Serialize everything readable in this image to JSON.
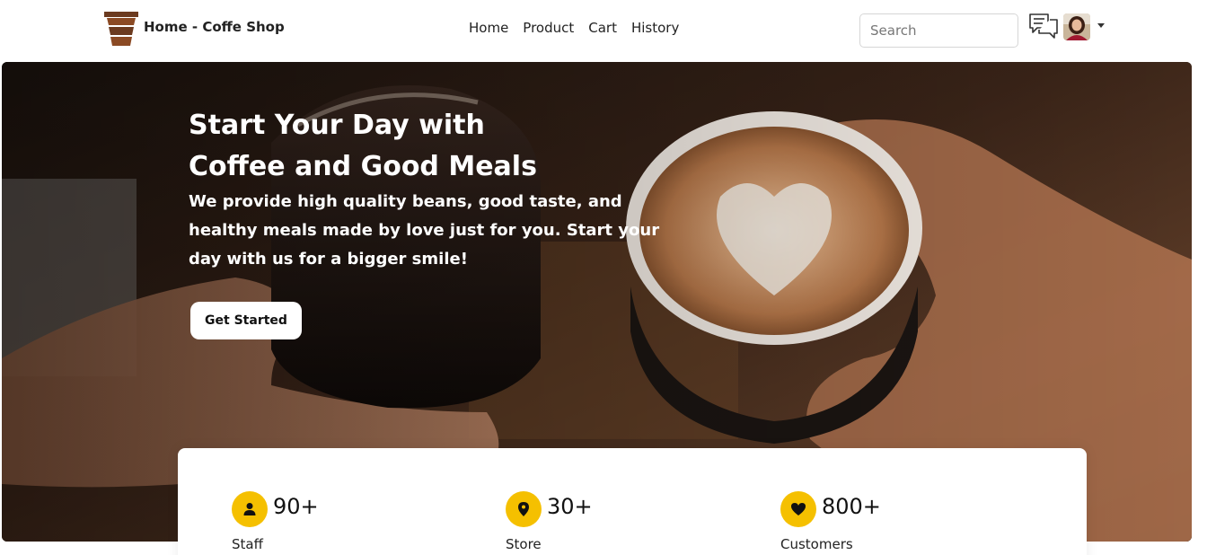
{
  "brand": {
    "title": "Home - Coffe Shop"
  },
  "nav": {
    "links": [
      "Home",
      "Product",
      "Cart",
      "History"
    ]
  },
  "search": {
    "placeholder": "Search"
  },
  "hero": {
    "title_line1": "Start Your Day with",
    "title_line2": "Coffee and Good Meals",
    "description": "We provide high quality beans, good taste, and healthy meals made by love just for you. Start your day with us for a bigger smile!",
    "button_label": "Get Started"
  },
  "stats": [
    {
      "value": "90+",
      "label": "Staff",
      "icon": "person-icon"
    },
    {
      "value": "30+",
      "label": "Store",
      "icon": "location-pin-icon"
    },
    {
      "value": "800+",
      "label": "Customers",
      "icon": "heart-icon"
    }
  ],
  "colors": {
    "accent": "#f5c000",
    "brand_brown": "#6b3a1f"
  }
}
